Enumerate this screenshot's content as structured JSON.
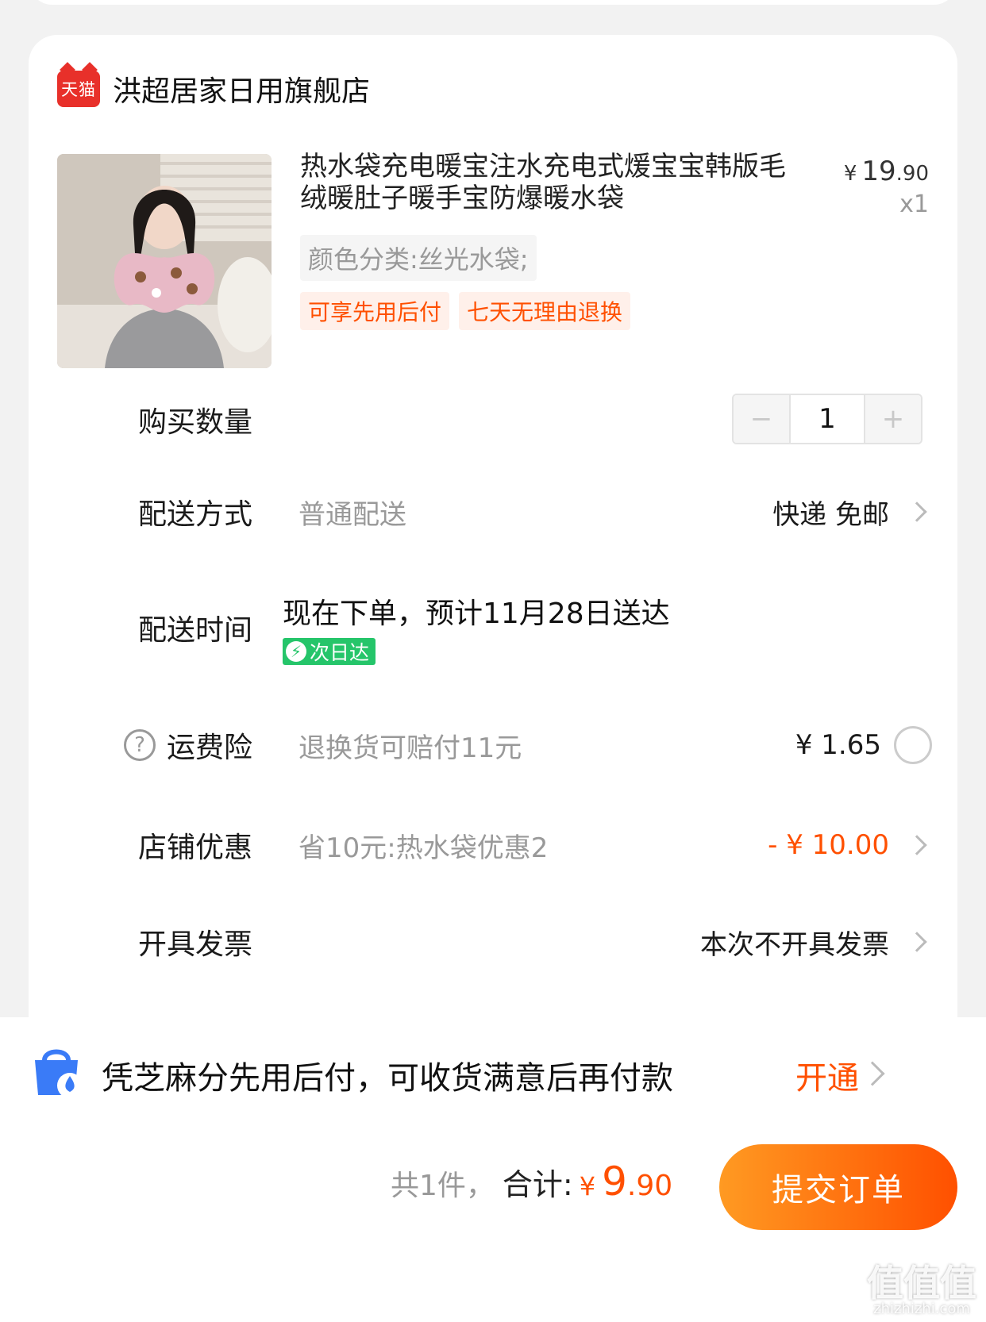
{
  "store": {
    "badge": "天猫",
    "name": "洪超居家日用旗舰店"
  },
  "product": {
    "title": "热水袋充电暖宝注水充电式煖宝宝韩版毛绒暖肚子暖手宝防爆暖水袋",
    "price_yen": "¥",
    "price_int": "19",
    "price_dec": ".90",
    "quantity_label": "x1",
    "sku": "颜色分类:丝光水袋;",
    "tags": [
      "可享先用后付",
      "七天无理由退换"
    ]
  },
  "quantity": {
    "label": "购买数量",
    "minus": "−",
    "value": "1",
    "plus": "+"
  },
  "shipping": {
    "label": "配送方式",
    "method": "普通配送",
    "value": "快递 免邮"
  },
  "delivery_time": {
    "label": "配送时间",
    "estimate": "现在下单，预计11月28日送达",
    "badge": "次日达"
  },
  "insurance": {
    "label": "运费险",
    "desc": "退换货可赔付11元",
    "price": "¥ 1.65"
  },
  "store_discount": {
    "label": "店铺优惠",
    "desc": "省10元:热水袋优惠2",
    "value": "- ¥ 10.00"
  },
  "invoice": {
    "label": "开具发票",
    "value": "本次不开具发票"
  },
  "pay_later": {
    "text": "凭芝麻分先用后付，可收货满意后再付款",
    "action": "开通"
  },
  "footer": {
    "count": "共1件，",
    "total_label": "合计:",
    "total_yen": "¥",
    "total_int": "9",
    "total_dec": ".90",
    "submit": "提交订单",
    "watermark": "值值值",
    "watermark_url": "zhizhizhi.com"
  },
  "colors": {
    "accent": "#ff5000",
    "tmall_red": "#e8302a",
    "green": "#25c56a"
  }
}
